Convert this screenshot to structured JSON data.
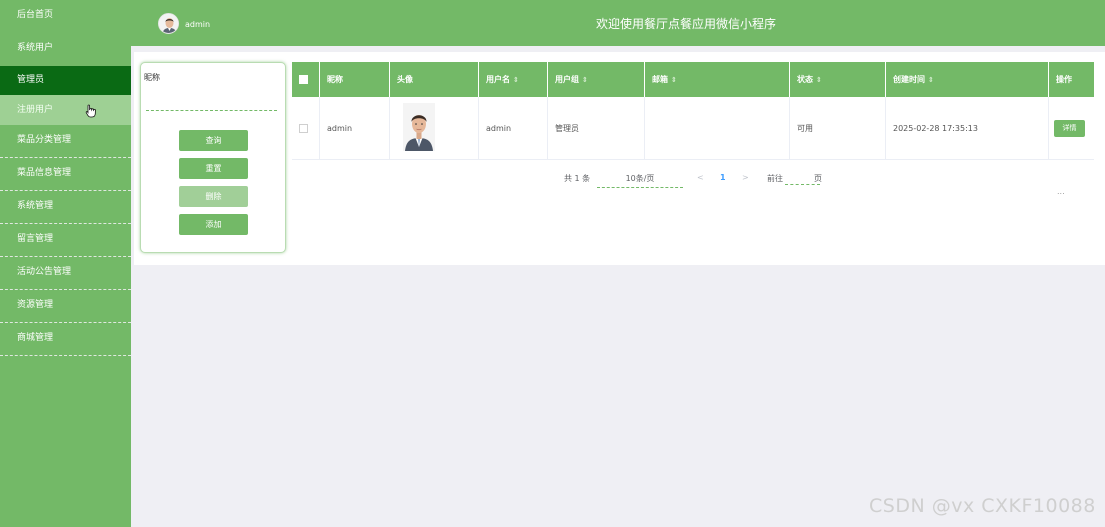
{
  "sidebar": {
    "items": [
      {
        "label": "后台首页"
      },
      {
        "label": "系统用户"
      },
      {
        "label": "管理员"
      },
      {
        "label": "注册用户"
      },
      {
        "label": "菜品分类管理"
      },
      {
        "label": "菜品信息管理"
      },
      {
        "label": "系统管理"
      },
      {
        "label": "留言管理"
      },
      {
        "label": "活动公告管理"
      },
      {
        "label": "资源管理"
      },
      {
        "label": "商城管理"
      }
    ]
  },
  "header": {
    "username": "admin",
    "title": "欢迎使用餐厅点餐应用微信小程序"
  },
  "search": {
    "field_label": "昵称",
    "buttons": {
      "query": "查询",
      "reset": "重置",
      "delete": "删除",
      "add": "添加"
    }
  },
  "table": {
    "headers": [
      "昵称",
      "头像",
      "用户名",
      "用户组",
      "邮箱",
      "状态",
      "创建时间",
      "操作"
    ],
    "rows": [
      {
        "nickname": "admin",
        "username": "admin",
        "group": "管理员",
        "email": "",
        "status": "可用",
        "created": "2025-02-28 17:35:13",
        "action": "详情",
        "more": "..."
      }
    ]
  },
  "pagination": {
    "total": "共 1 条",
    "page_size": "10条/页",
    "prev": "<",
    "current": "1",
    "next": ">",
    "goto": "前往",
    "page_unit": "页"
  },
  "watermark": "CSDN @vx  CXKF10088",
  "colors": {
    "primary": "#73b967",
    "active": "#0a6a14",
    "sub_active": "#9ed094",
    "background": "#efeff4"
  }
}
